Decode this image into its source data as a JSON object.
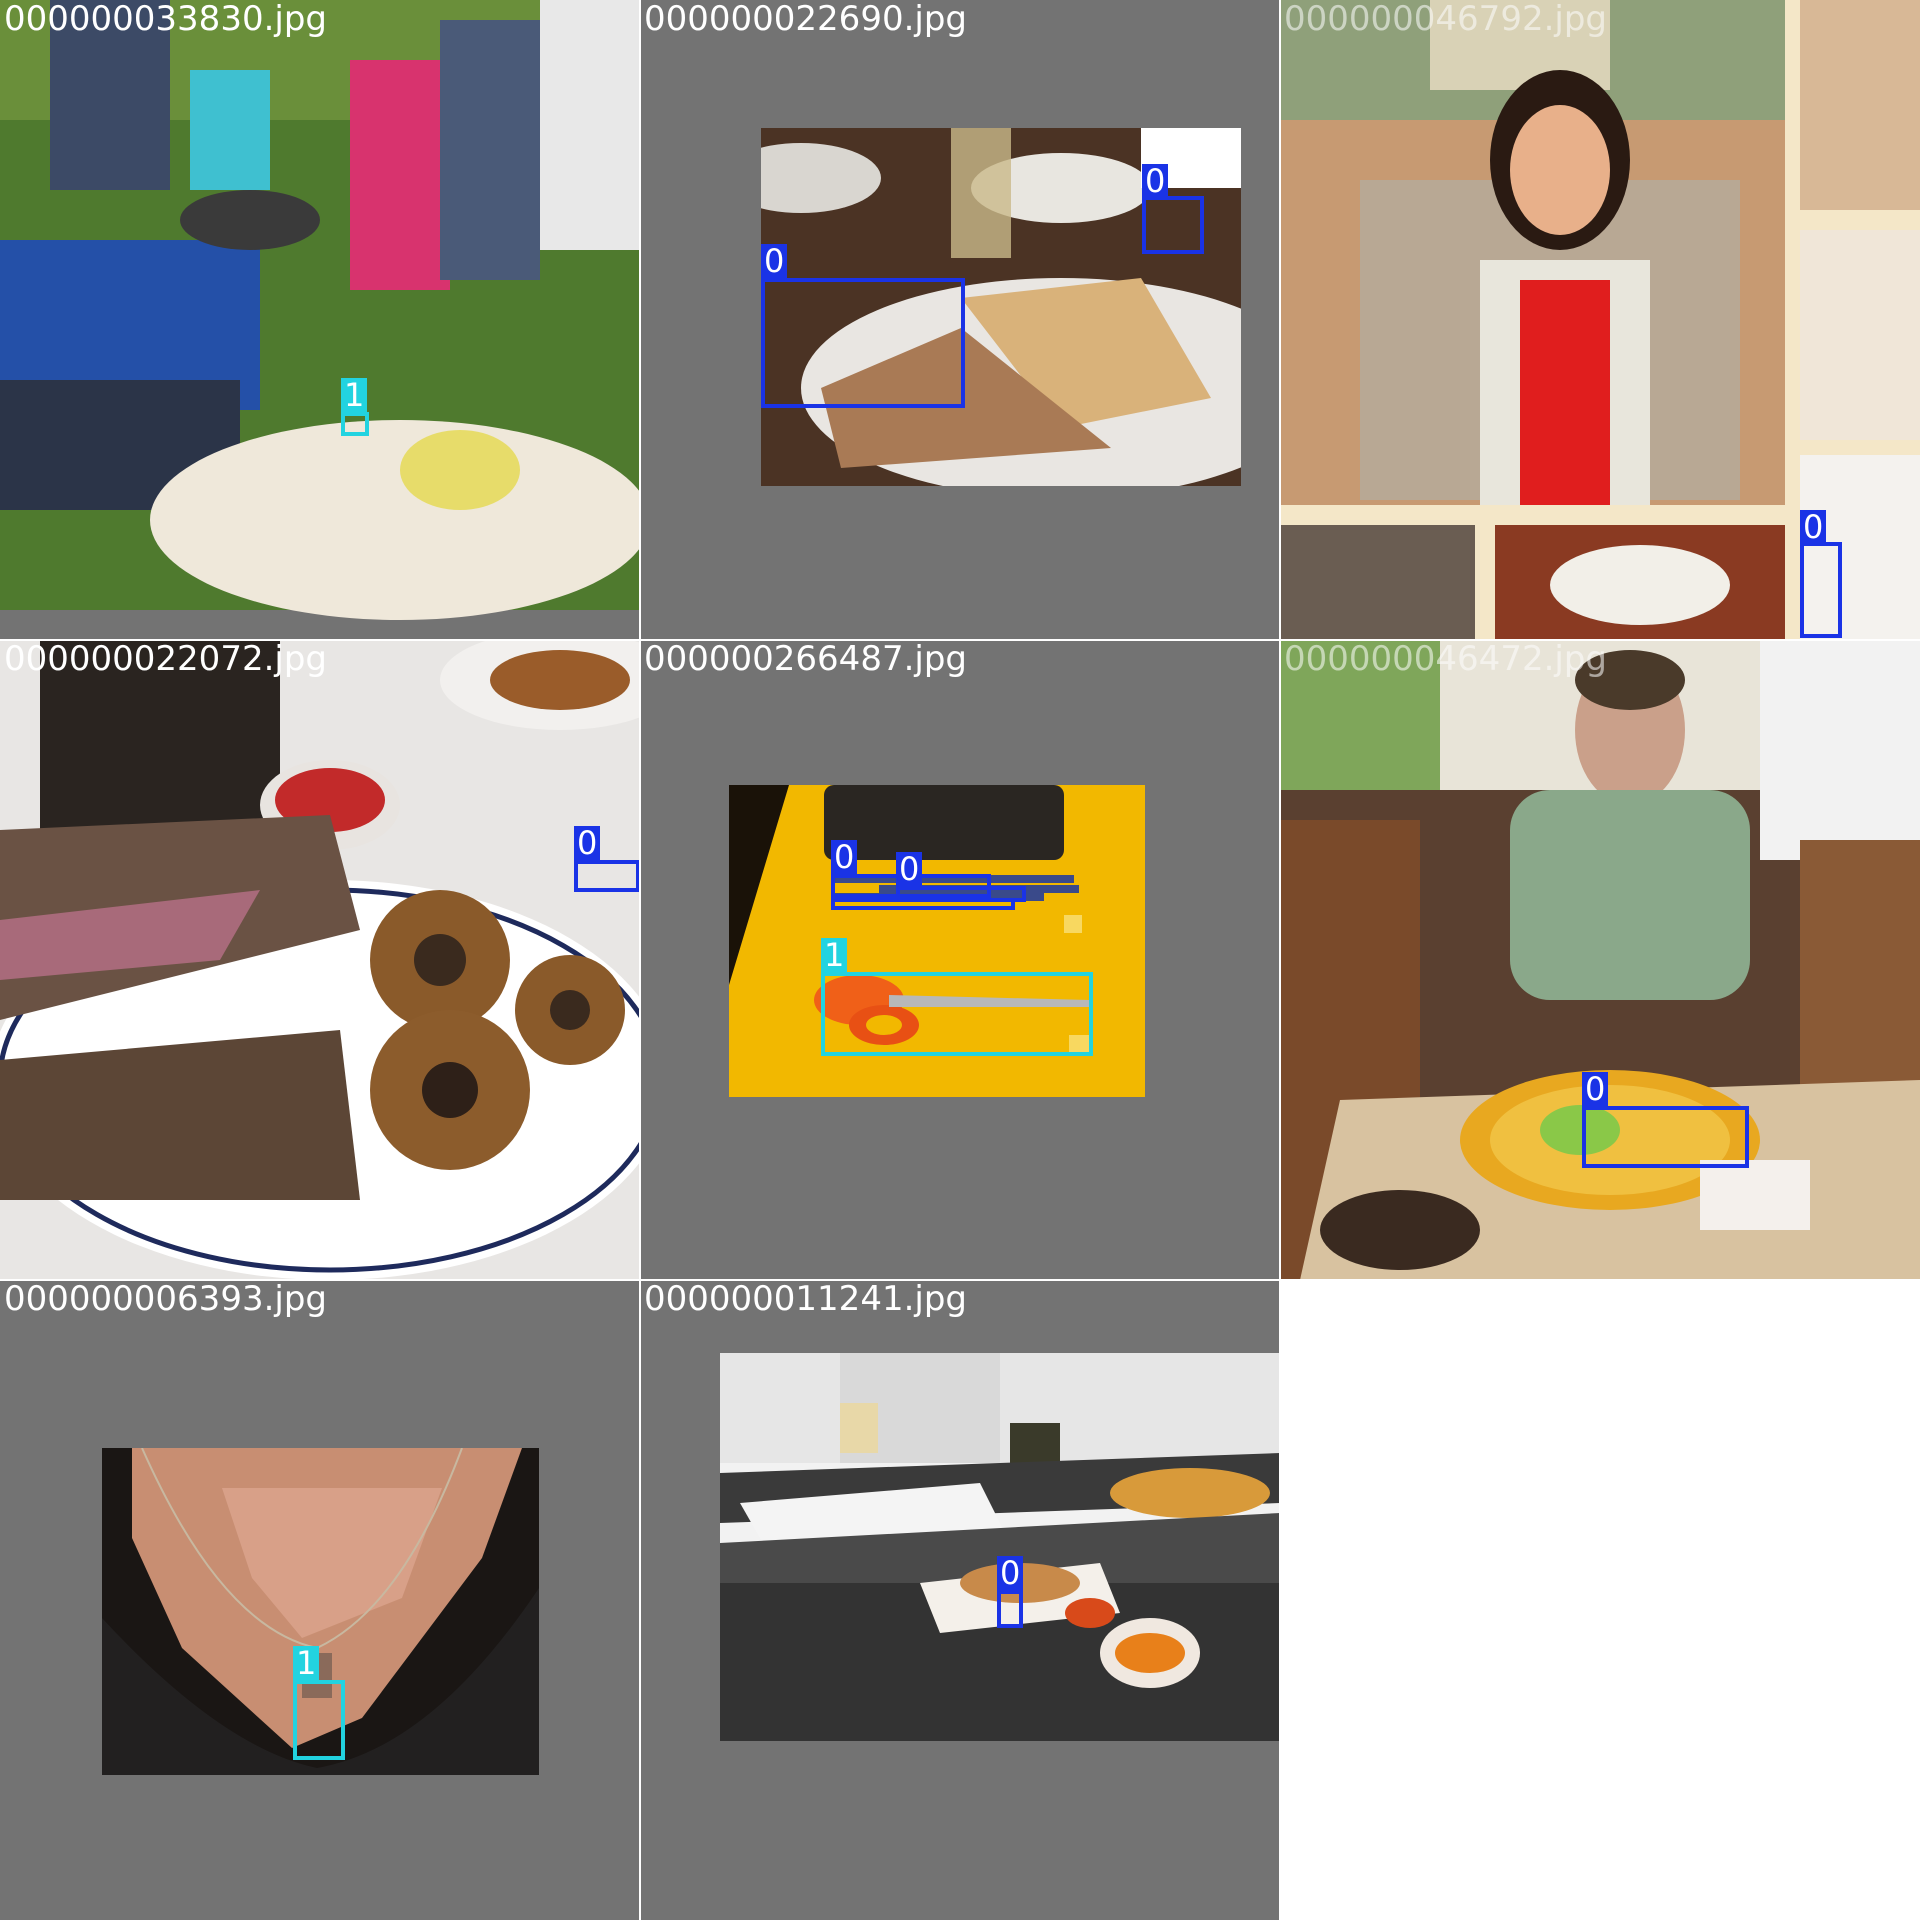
{
  "tiles": [
    {
      "filename": "000000033830.jpg",
      "labels": [
        "1"
      ]
    },
    {
      "filename": "000000022690.jpg",
      "labels": [
        "0",
        "0"
      ]
    },
    {
      "filename": "000000046792.jpg",
      "labels": [
        "0"
      ]
    },
    {
      "filename": "000000022072.jpg",
      "labels": [
        "0"
      ]
    },
    {
      "filename": "000000266487.jpg",
      "labels": [
        "0",
        "0",
        "0",
        "1"
      ]
    },
    {
      "filename": "000000046472.jpg",
      "labels": [
        "0"
      ]
    },
    {
      "filename": "000000006393.jpg",
      "labels": [
        "1"
      ]
    },
    {
      "filename": "000000011241.jpg",
      "labels": [
        "0"
      ]
    }
  ],
  "colors": {
    "class_0": "#1a33e6",
    "class_1": "#22d3e0",
    "padding": "#737373"
  }
}
